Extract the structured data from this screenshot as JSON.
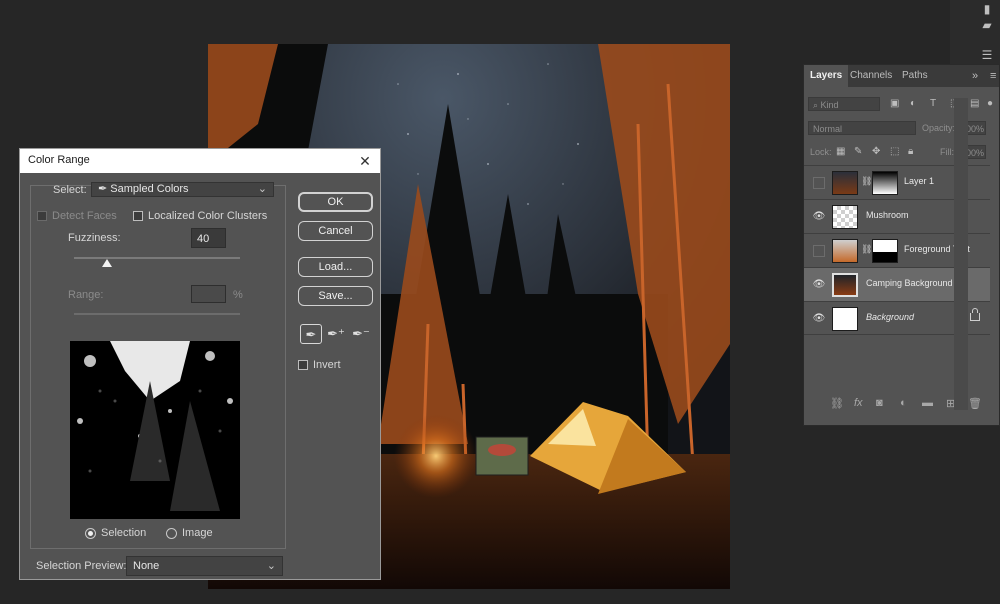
{
  "app": {
    "workspace_color": "#262626"
  },
  "canvas": {
    "description_icon": "photo-canvas"
  },
  "right_toolbar": {
    "icons": [
      "brush-settings-icon",
      "comment-icon",
      "properties-icon"
    ]
  },
  "layers_panel": {
    "tabs": [
      "Layers",
      "Channels",
      "Paths"
    ],
    "kind_placeholder": "Kind",
    "blend_mode": "Normal",
    "opacity_label": "Opacity:",
    "opacity_value": "100%",
    "lock_label": "Lock:",
    "fill_label": "Fill:",
    "fill_value": "100%",
    "layers": [
      {
        "name": "Layer 1",
        "visible": false,
        "has_mask": true,
        "selected": false
      },
      {
        "name": "Mushroom",
        "visible": true,
        "has_mask": false,
        "selected": false
      },
      {
        "name": "Foreground Tent",
        "visible": false,
        "has_mask": true,
        "selected": false
      },
      {
        "name": "Camping Background",
        "visible": true,
        "has_mask": false,
        "selected": true
      },
      {
        "name": "Background",
        "visible": true,
        "has_mask": false,
        "selected": false,
        "locked": true
      }
    ],
    "footer_icons": [
      "link-icon",
      "fx-icon",
      "mask-icon",
      "adjustment-icon",
      "folder-icon",
      "new-layer-icon",
      "trash-icon"
    ],
    "footer_fx": "fx"
  },
  "dialog": {
    "title": "Color Range",
    "select_label": "Select:",
    "select_value": "Sampled Colors",
    "detect_faces": "Detect Faces",
    "localized_clusters": "Localized Color Clusters",
    "fuzziness_label": "Fuzziness:",
    "fuzziness_value": "40",
    "fuzziness_fraction": 0.2,
    "range_label": "Range:",
    "range_unit": "%",
    "radio_selection": "Selection",
    "radio_image": "Image",
    "radio_checked": "Selection",
    "selection_preview_label": "Selection Preview:",
    "selection_preview_value": "None",
    "buttons": {
      "ok": "OK",
      "cancel": "Cancel",
      "load": "Load...",
      "save": "Save..."
    },
    "invert_label": "Invert",
    "close_glyph": "✕"
  }
}
